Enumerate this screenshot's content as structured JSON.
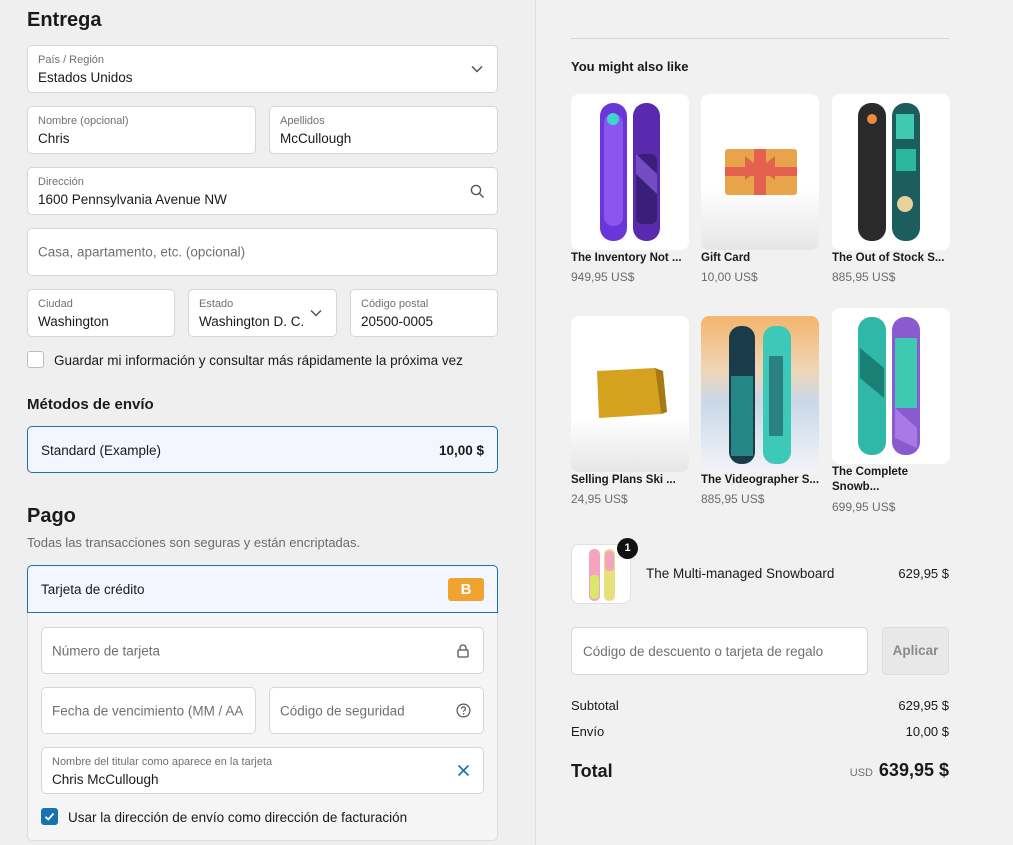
{
  "delivery": {
    "heading": "Entrega",
    "country": {
      "label": "País / Región",
      "value": "Estados Unidos"
    },
    "first_name": {
      "label": "Nombre (opcional)",
      "value": "Chris"
    },
    "last_name": {
      "label": "Apellidos",
      "value": "McCullough"
    },
    "address": {
      "label": "Dirección",
      "value": "1600 Pennsylvania Avenue NW"
    },
    "apartment": {
      "placeholder": "Casa, apartamento, etc. (opcional)"
    },
    "city": {
      "label": "Ciudad",
      "value": "Washington"
    },
    "state": {
      "label": "Estado",
      "value": "Washington D. C."
    },
    "zip": {
      "label": "Código postal",
      "value": "20500-0005"
    },
    "save_info": {
      "label": "Guardar mi información y consultar más rápidamente la próxima vez",
      "checked": false
    }
  },
  "shipping": {
    "heading": "Métodos de envío",
    "option": {
      "name": "Standard (Example)",
      "price": "10,00 $"
    }
  },
  "payment": {
    "heading": "Pago",
    "subtitle": "Todas las transacciones son seguras y están encriptadas.",
    "method": {
      "name": "Tarjeta de crédito",
      "badge": "B"
    },
    "card_number": {
      "placeholder": "Número de tarjeta"
    },
    "expiry": {
      "placeholder": "Fecha de vencimiento (MM / AA"
    },
    "cvv": {
      "placeholder": "Código de seguridad"
    },
    "holder": {
      "label": "Nombre del titular como aparece en la tarjeta",
      "value": "Chris McCullough"
    },
    "billing_same": {
      "label": "Usar la dirección de envío como dirección de facturación",
      "checked": true
    }
  },
  "recommendations": {
    "heading": "You might also like",
    "items": [
      {
        "title": "The Inventory Not ...",
        "price": "949,95 US$"
      },
      {
        "title": "Gift Card",
        "price": "10,00 US$"
      },
      {
        "title": "The Out of Stock S...",
        "price": "885,95 US$"
      },
      {
        "title": "Selling Plans Ski ...",
        "price": "24,95 US$"
      },
      {
        "title": "The Videographer S...",
        "price": "885,95 US$"
      },
      {
        "title": "The Complete Snowb...",
        "price": "699,95 US$"
      }
    ]
  },
  "cart": {
    "item": {
      "name": "The Multi-managed Snowboard",
      "price": "629,95 $",
      "quantity": "1"
    },
    "discount": {
      "placeholder": "Código de descuento o tarjeta de regalo",
      "button": "Aplicar"
    },
    "subtotal": {
      "label": "Subtotal",
      "value": "629,95 $"
    },
    "shipping": {
      "label": "Envío",
      "value": "10,00 $"
    },
    "total": {
      "label": "Total",
      "currency": "USD",
      "value": "639,95 $"
    }
  },
  "colors": {
    "accent": "#1773b0",
    "badge": "#f0a330"
  }
}
